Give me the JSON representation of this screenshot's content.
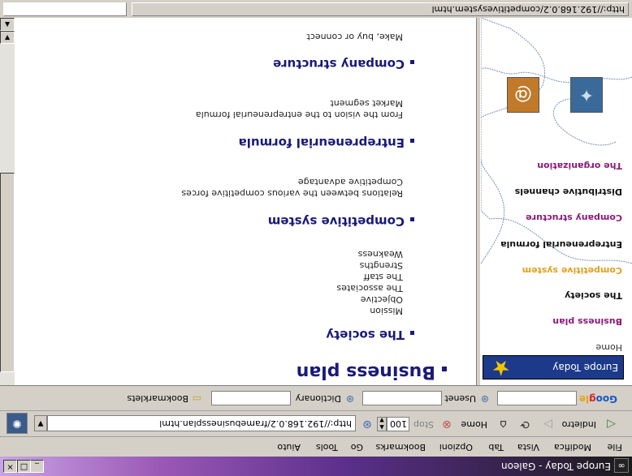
{
  "window": {
    "title": "Europe Today - Galeon",
    "app_icon": "galeon-icon",
    "controls": [
      "_",
      "□",
      "×"
    ]
  },
  "menu": [
    "File",
    "Modifica",
    "Vista",
    "Tab",
    "Opzioni",
    "Bookmarks",
    "Go",
    "Tools",
    "Aiuto"
  ],
  "nav": {
    "back_label": "Indietro",
    "home_label": "Home",
    "stop_label": "Stop",
    "zoom": "100",
    "url": "http://192.168.0.2/framebusinessplan.html"
  },
  "googlebar": {
    "logo": [
      "Goo",
      "g",
      "le"
    ],
    "usenet_label": "Usenet",
    "dictionary_label": "Dictionary",
    "bookmarklets_label": "Bookmarklets"
  },
  "sidebar": {
    "banner": "Europe Today",
    "links": [
      {
        "label": "Home",
        "color": "#333333"
      },
      {
        "label": "Business plan",
        "color": "#8a1a7a"
      },
      {
        "label": "The society",
        "color": "#111111"
      },
      {
        "label": "Competitive system",
        "color": "#e0a020"
      },
      {
        "label": "Entrepreneurial formula",
        "color": "#111111"
      },
      {
        "label": "Company structure",
        "color": "#8a1a7a"
      },
      {
        "label": "Distributive channels",
        "color": "#111111"
      },
      {
        "label": "The organization",
        "color": "#8a1a7a"
      }
    ]
  },
  "main": {
    "heading": "Business plan",
    "sections": [
      {
        "title": "The society",
        "items": [
          "Mission",
          "Objective",
          "The associates",
          "The staff",
          "Strengths",
          "Weakness"
        ]
      },
      {
        "title": "Competitive system",
        "items": [
          "Relations between the various competitive forces",
          "Competitive advantage"
        ]
      },
      {
        "title": "Entrepreneurial formula",
        "items": [
          "From the vision to the entrepreneurial formula",
          "Market segment"
        ]
      },
      {
        "title": "Company structure",
        "items": [
          "Make, buy or connect"
        ]
      }
    ]
  },
  "status": {
    "text": "http://192.168.0.2/competitivesystem.html"
  },
  "colors": {
    "heading": "#1a1a78",
    "title_gradient": [
      "#1a1a1a",
      "#9b59b6"
    ]
  }
}
